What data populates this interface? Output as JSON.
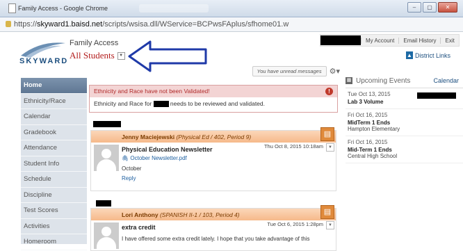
{
  "window": {
    "title": "Family Access - Google Chrome",
    "buttons": [
      "–",
      "▢",
      "✕"
    ]
  },
  "address": {
    "url_prefix": "https://",
    "url_host": "skyward1.baisd.net",
    "url_path": "/scripts/wsisa.dll/WService=BCPwsFAplus/sfhome01.w"
  },
  "header": {
    "logo": "SKYWARD",
    "app_title": "Family Access",
    "student_selector": "All Students"
  },
  "topnav": {
    "items": [
      "My Account",
      "Email History",
      "Exit"
    ]
  },
  "district_links": {
    "label": "District Links",
    "icon": "building-icon"
  },
  "sidebar": {
    "items": [
      "Home",
      "Ethnicity/Race",
      "Calendar",
      "Gradebook",
      "Attendance",
      "Student Info",
      "Schedule",
      "Discipline",
      "Test Scores",
      "Activities",
      "Homeroom"
    ]
  },
  "messages": {
    "unread_label": "You have unread messages"
  },
  "alert": {
    "title": "Ethnicity and Race have not been Validated!",
    "body_pre": "Ethnicity and Race for",
    "body_post": "needs to be reviewed and validated."
  },
  "posts": [
    {
      "author": "Jenny Maciejewski",
      "course": "(Physical Ed / 402, Period 9)",
      "subject": "Physical Education Newsletter",
      "date": "Thu Oct 8, 2015 10:18am",
      "attachment": "October Newsletter.pdf",
      "body": "October",
      "reply": "Reply"
    },
    {
      "author": "Lori Anthony",
      "course": "(SPANISH II-1 / 103, Period 4)",
      "subject": "extra credit",
      "date": "Tue Oct 6, 2015 1:28pm",
      "body": "I have offered some extra credit lately. I hope that you take advantage of this"
    }
  ],
  "upcoming": {
    "title": "Upcoming Events",
    "calendar_link": "Calendar",
    "events": [
      {
        "date": "Tue Oct 13, 2015",
        "title": "Lab 3 Volume",
        "location": ""
      },
      {
        "date": "Fri Oct 16, 2015",
        "title": "MidTerm 1 Ends",
        "location": "Hampton Elementary"
      },
      {
        "date": "Fri Oct 16, 2015",
        "title": "Mid-Term 1 Ends",
        "location": "Central High School"
      }
    ]
  },
  "colors": {
    "accent": "#1d4f7f",
    "alert": "#b02a2a",
    "card_header": "#f6b98a",
    "arrow": "#1f3aa8"
  }
}
